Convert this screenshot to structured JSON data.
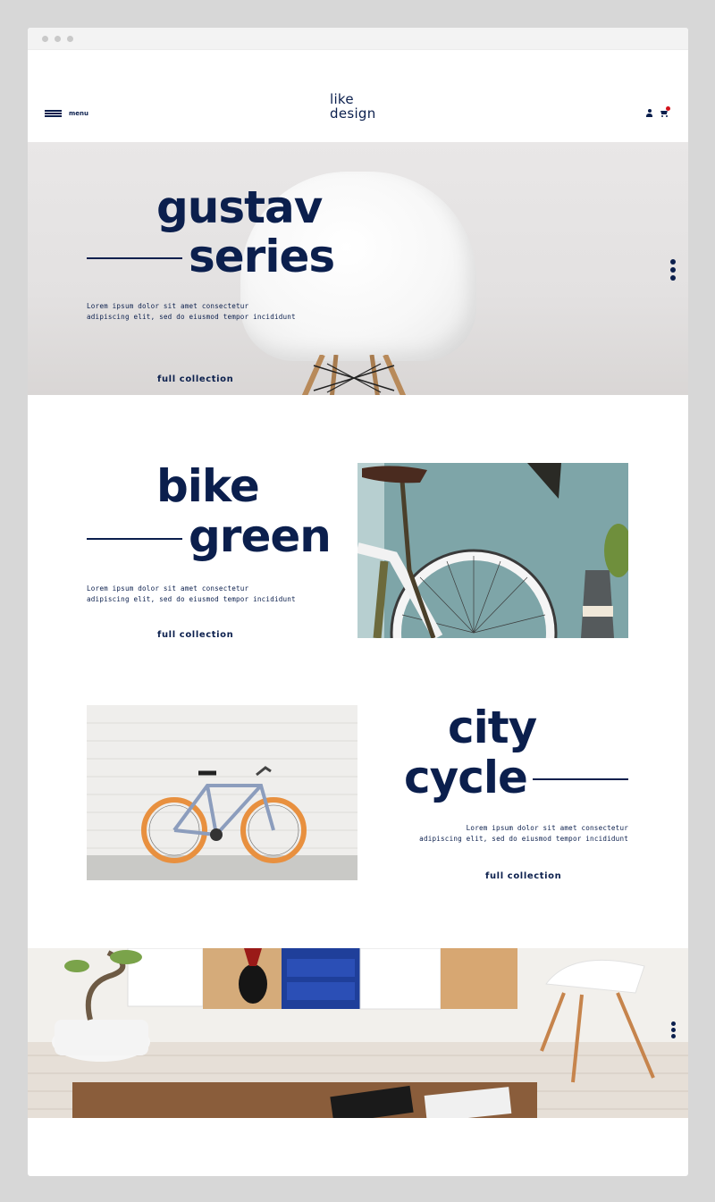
{
  "nav": {
    "menu_label": "menu",
    "logo_line1": "like",
    "logo_line2": "design"
  },
  "hero": {
    "title_line1": "gustav",
    "title_line2": "series",
    "description_line1": "Lorem ipsum dolor sit amet consectetur",
    "description_line2": "adipiscing elit, sed do eiusmod tempor incididunt",
    "cta": "full collection"
  },
  "sections": [
    {
      "title_line1": "bike",
      "title_line2": "green",
      "description_line1": "Lorem ipsum dolor sit amet consectetur",
      "description_line2": "adipiscing elit, sed do eiusmod tempor incididunt",
      "cta": "full collection"
    },
    {
      "title_line1": "city",
      "title_line2": "cycle",
      "description_line1": "Lorem ipsum dolor sit amet consectetur",
      "description_line2": "adipiscing elit, sed do eiusmod tempor incididunt",
      "cta": "full collection"
    }
  ],
  "colors": {
    "brand_navy": "#0b1f4d",
    "cart_badge": "#d3131c",
    "page_background": "#d7d7d7"
  },
  "icons": [
    "hamburger-icon",
    "user-icon",
    "cart-icon"
  ]
}
